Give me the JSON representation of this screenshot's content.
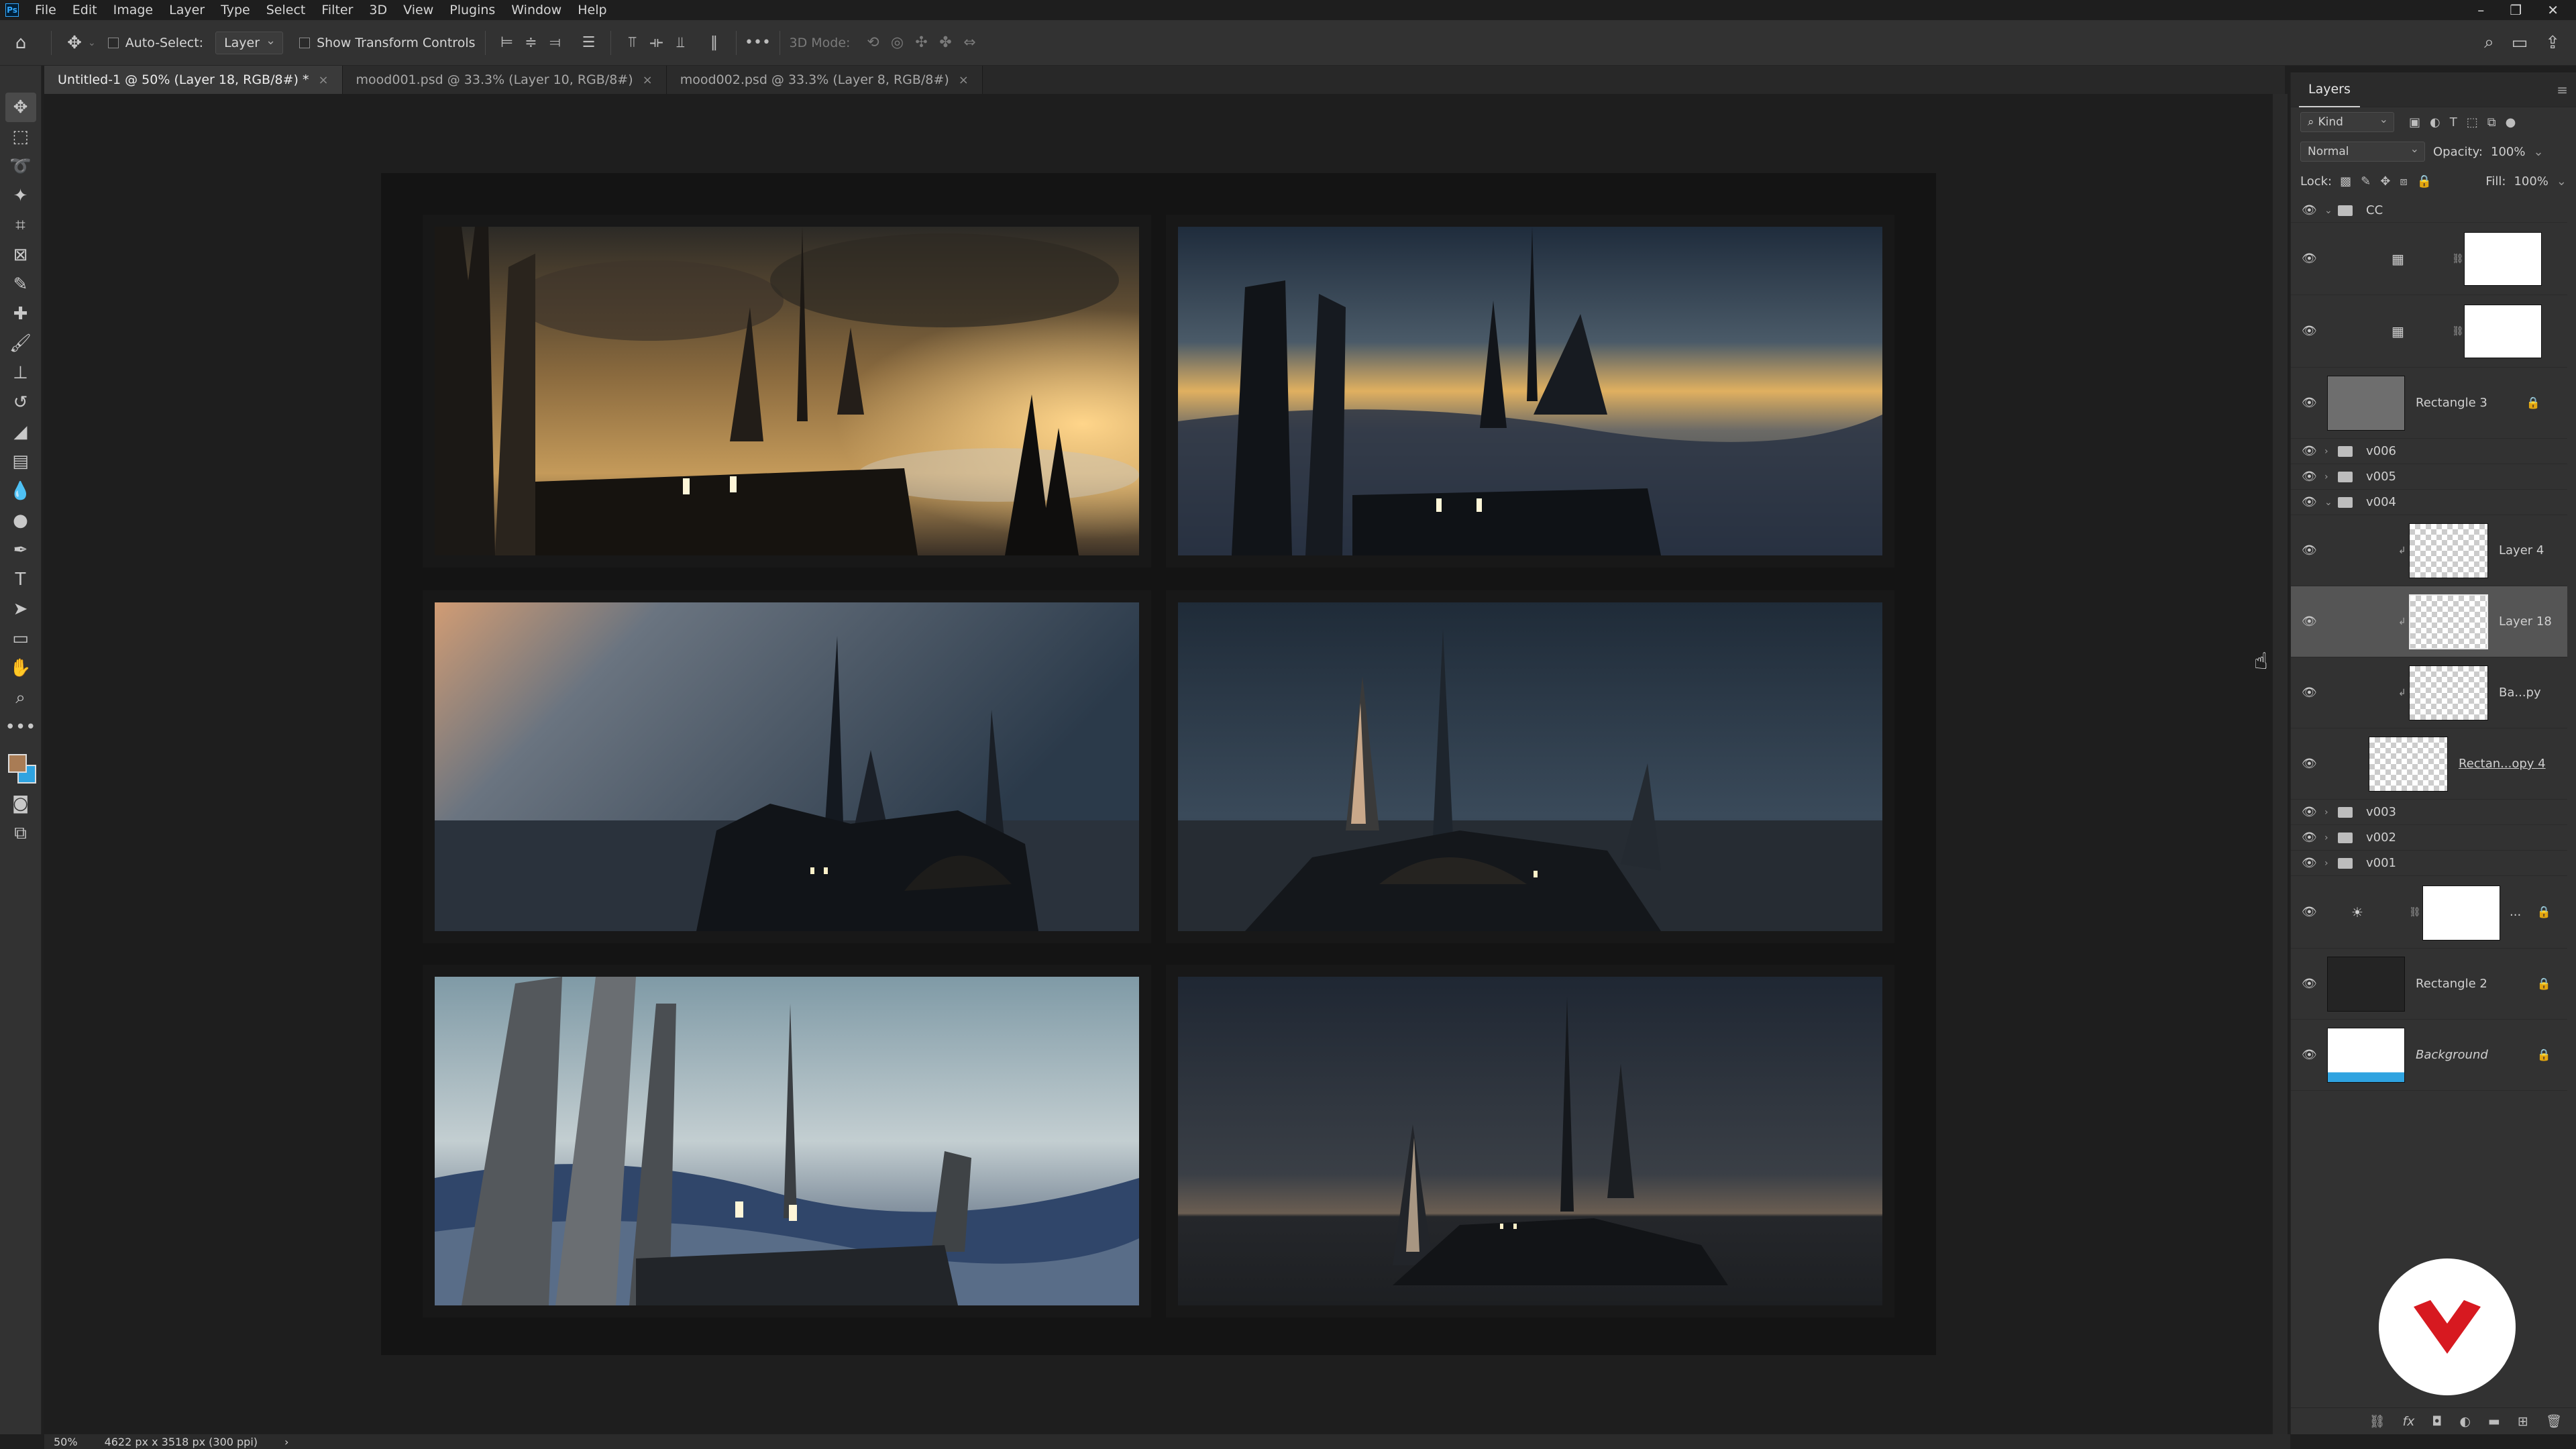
{
  "menubar": {
    "app_icon": "photoshop-logo",
    "items": [
      "File",
      "Edit",
      "Image",
      "Layer",
      "Type",
      "Select",
      "Filter",
      "3D",
      "View",
      "Plugins",
      "Window",
      "Help"
    ]
  },
  "options": {
    "auto_select_label": "Auto-Select:",
    "auto_select_target": "Layer",
    "show_transform_label": "Show Transform Controls",
    "threed_mode_label": "3D Mode:"
  },
  "tabs": [
    {
      "label": "Untitled-1 @ 50% (Layer 18, RGB/8#) *",
      "active": true
    },
    {
      "label": "mood001.psd @ 33.3% (Layer 10, RGB/8#)",
      "active": false
    },
    {
      "label": "mood002.psd @ 33.3% (Layer 8, RGB/8#)",
      "active": false
    }
  ],
  "tools": [
    "move-icon",
    "marquee-icon",
    "lasso-icon",
    "magic-wand-icon",
    "crop-icon",
    "frame-icon",
    "eyedropper-icon",
    "healing-brush-icon",
    "brush-icon",
    "clone-stamp-icon",
    "history-brush-icon",
    "eraser-icon",
    "gradient-icon",
    "blur-icon",
    "dodge-icon",
    "pen-icon",
    "type-icon",
    "path-selection-icon",
    "rectangle-icon",
    "hand-icon",
    "zoom-icon",
    "more-tools-icon"
  ],
  "colors": {
    "foreground": "#a97c55",
    "background": "#2fa3e0"
  },
  "layers_panel": {
    "tab_label": "Layers",
    "filter_kind": "Kind",
    "blend_mode": "Normal",
    "opacity_label": "Opacity:",
    "opacity_value": "100%",
    "lock_label": "Lock:",
    "fill_label": "Fill:",
    "fill_value": "100%",
    "layers": {
      "cc": "CC",
      "rectangle3": "Rectangle 3",
      "v006": "v006",
      "v005": "v005",
      "v004": "v004",
      "layer4": "Layer 4",
      "layer18": "Layer 18",
      "bapy": "Ba...py",
      "rectcopy4": "Rectan...opy 4",
      "v003": "v003",
      "v002": "v002",
      "v001": "v001",
      "adj_dots": "...",
      "rectangle2": "Rectangle 2",
      "background": "Background"
    }
  },
  "status": {
    "zoom": "50%",
    "doc_info": "4622 px x 3518 px (300 ppi)"
  }
}
